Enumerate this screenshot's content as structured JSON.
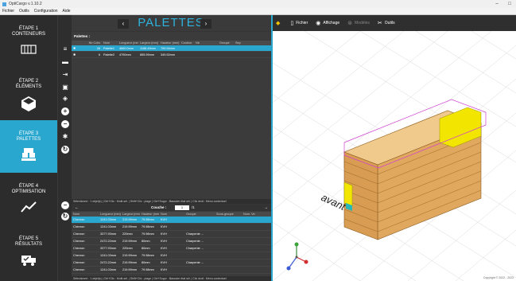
{
  "window": {
    "title": "OptiCargo v.1.10.2"
  },
  "menu": [
    "Fichier",
    "Outils",
    "Configuration",
    "Aide"
  ],
  "steps": [
    {
      "line1": "ÉTAPE 1",
      "line2": "CONTENEURS"
    },
    {
      "line1": "ÉTAPE 2",
      "line2": "ÉLÉMENTS"
    },
    {
      "line1": "ÉTAPE 3",
      "line2": "PALETTES"
    },
    {
      "line1": "ÉTAPE 4",
      "line2": "OPTIMISATION"
    },
    {
      "line1": "ÉTAPE 5",
      "line2": "RÉSULTATS"
    }
  ],
  "palettes": {
    "title": "PALETTES",
    "section_label": "Palettes :",
    "columns": [
      "Nb Colis",
      "Nom",
      "Longueur (mm)",
      "Largeur (mm)",
      "Hauteur (mm)",
      "Couleur",
      "Nb",
      "Groupe",
      "Sep"
    ],
    "rows": [
      [
        "26",
        "Palette1",
        "4660.0mm",
        "1168.49mm",
        "799.94mm",
        "",
        "",
        "",
        ""
      ],
      [
        "6",
        "Palette2",
        "4790mm",
        "855.99mm",
        "349.92mm",
        "",
        "",
        "",
        ""
      ]
    ],
    "status": "Sélectionné : 1 objet(s) | Ctrl+Clic : Multi-sél. | Shift+Clic : plage | Ctrl+Suppr : Basculer état sél. | Clic droit : Menu contextuel"
  },
  "colis": {
    "nav_label": "Couche :",
    "current": "1",
    "total": "/1",
    "columns": [
      "Nom",
      "Longueur (mm)",
      "Largeur (mm)",
      "Hauteur (mm)",
      "Nom",
      "Groupe",
      "Sous-groupe",
      "Num. Ve"
    ],
    "rows": [
      [
        "Chevron",
        "1241.03mm",
        "219.99mm",
        "79.98mm",
        "KVH",
        "",
        "",
        ""
      ],
      [
        "Chevron",
        "1241.03mm",
        "219.99mm",
        "79.98mm",
        "KVH",
        "",
        "",
        ""
      ],
      [
        "Chevron",
        "3377.93mm",
        "220mm",
        "79.98mm",
        "KVH",
        "Charpente ...",
        "",
        ""
      ],
      [
        "Chevron",
        "2472.22mm",
        "219.99mm",
        "80mm",
        "KVH",
        "Charpente ...",
        "",
        ""
      ],
      [
        "Chevron",
        "3377.93mm",
        "220mm",
        "80mm",
        "KVH",
        "Charpente ...",
        "",
        ""
      ],
      [
        "Chevron",
        "1241.03mm",
        "219.99mm",
        "79.98mm",
        "KVH",
        "",
        "",
        ""
      ],
      [
        "Chevron",
        "2472.22mm",
        "219.99mm",
        "80mm",
        "KVH",
        "Charpente ...",
        "",
        ""
      ],
      [
        "Chevron",
        "1241.03mm",
        "219.99mm",
        "79.98mm",
        "KVH",
        "",
        "",
        ""
      ]
    ],
    "status": "Sélectionné : 1 objet(s) | Ctrl+Clic : Multi-sél. | Shift+Clic : plage | Ctrl+Suppr : Basculer état sél. | Clic droit : Menu contextuel"
  },
  "viewer": {
    "toolbar": {
      "file": "Fichier",
      "display": "Affichage",
      "models": "Modèles",
      "tools": "Outils"
    },
    "label_front": "avant",
    "copyright": "Copyright © 2022 - 2023"
  },
  "colors": {
    "accent": "#2aa7cf",
    "title": "#2fb3dd",
    "wood": "#e8b168",
    "yellow": "#f2e600"
  }
}
